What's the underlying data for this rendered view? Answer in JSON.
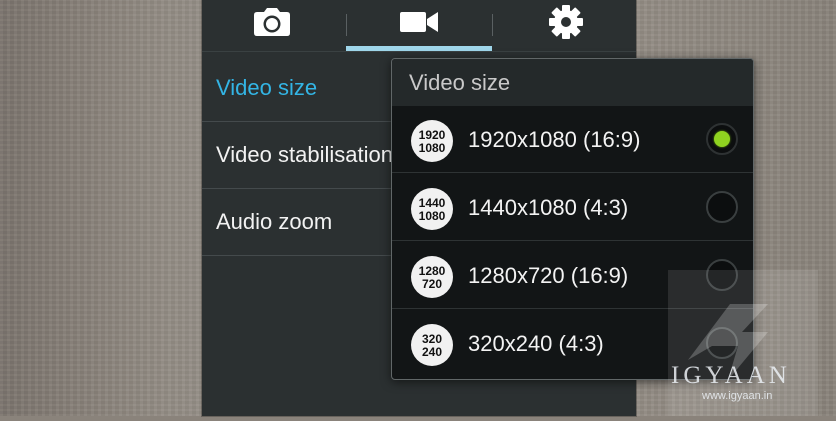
{
  "tabs": [
    {
      "name": "Photo",
      "icon": "camera-icon"
    },
    {
      "name": "Video",
      "icon": "video-camera-icon",
      "selected": true
    },
    {
      "name": "Settings",
      "icon": "gear-icon"
    }
  ],
  "menu": {
    "items": [
      {
        "label": "Video size",
        "highlighted": true
      },
      {
        "label": "Video stabilisation"
      },
      {
        "label": "Audio zoom"
      }
    ]
  },
  "popup": {
    "title": "Video size",
    "options": [
      {
        "label": "1920x1080 (16:9)",
        "icon_top": "1920",
        "icon_bottom": "1080",
        "selected": true
      },
      {
        "label": "1440x1080 (4:3)",
        "icon_top": "1440",
        "icon_bottom": "1080",
        "selected": false
      },
      {
        "label": "1280x720 (16:9)",
        "icon_top": "1280",
        "icon_bottom": "720",
        "selected": false
      },
      {
        "label": "320x240 (4:3)",
        "icon_top": "320",
        "icon_bottom": "240",
        "selected": false
      }
    ]
  },
  "watermark": {
    "brand": "IGYAAN",
    "url": "www.igyaan.in"
  },
  "colors": {
    "accent": "#33b5e5",
    "tab_indicator": "#9fd6ea",
    "radio_selected": "#8fd320",
    "panel": "#2b3031"
  }
}
